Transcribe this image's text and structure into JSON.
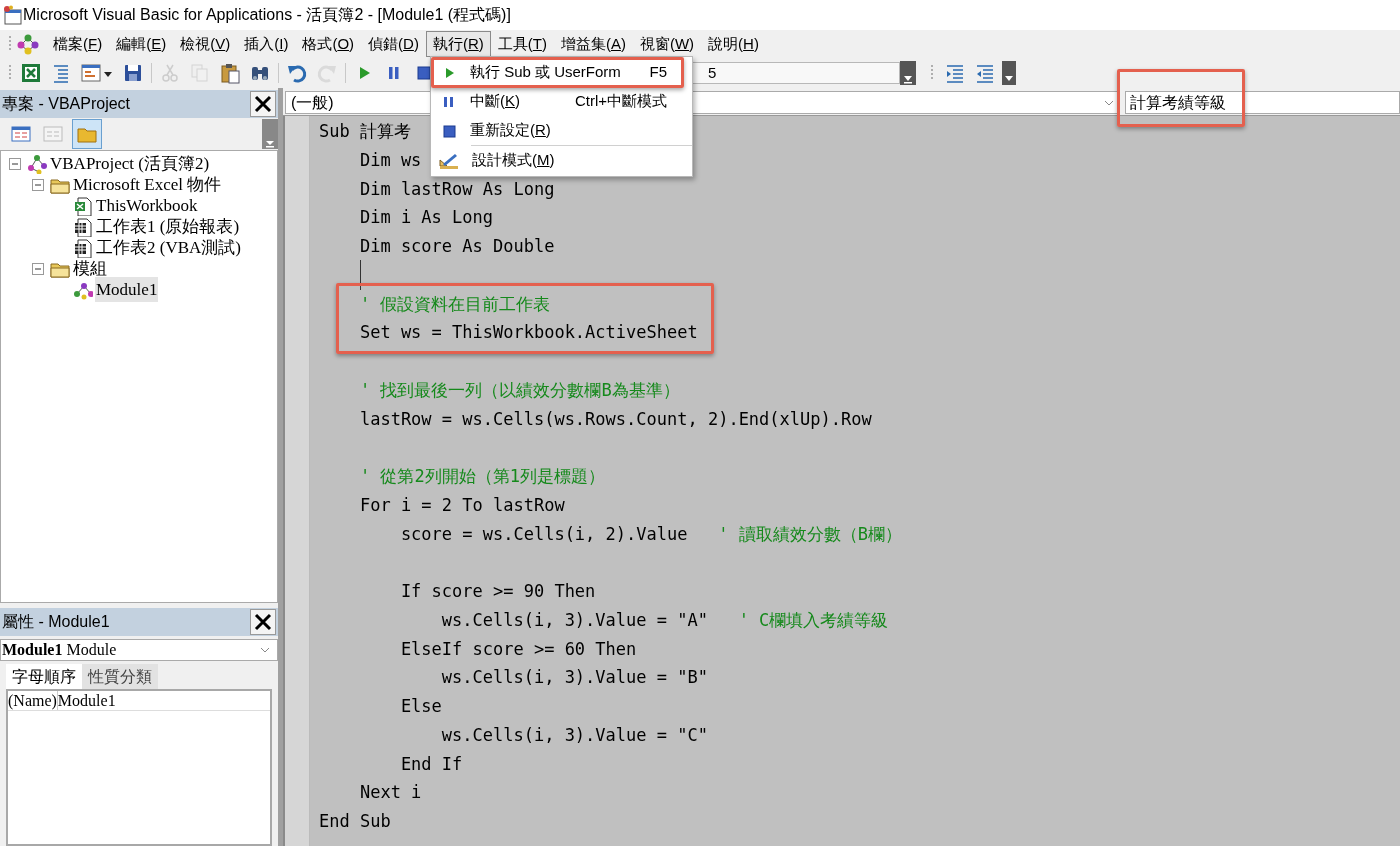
{
  "window": {
    "title": "Microsoft Visual Basic for Applications - 活頁簿2 - [Module1 (程式碼)]"
  },
  "menu_bar": [
    {
      "label": "檔案(F)",
      "selected": false
    },
    {
      "label": "編輯(E)",
      "selected": false
    },
    {
      "label": "檢視(V)",
      "selected": false
    },
    {
      "label": "插入(I)",
      "selected": false
    },
    {
      "label": "格式(O)",
      "selected": false
    },
    {
      "label": "偵錯(D)",
      "selected": false
    },
    {
      "label": "執行(R)",
      "selected": true
    },
    {
      "label": "工具(T)",
      "selected": false
    },
    {
      "label": "增益集(A)",
      "selected": false
    },
    {
      "label": "視窗(W)",
      "selected": false
    },
    {
      "label": "說明(H)",
      "selected": false
    }
  ],
  "toolbar": {
    "buttons": [
      {
        "disabled": false
      },
      {
        "disabled": false
      },
      {
        "disabled": false
      },
      {
        "disabled": false
      },
      {
        "disabled": true
      },
      {
        "disabled": true
      },
      {
        "disabled": false
      },
      {
        "disabled": false
      },
      {
        "disabled": false
      },
      {
        "disabled": true
      },
      {
        "disabled": false
      },
      {
        "disabled": false
      },
      {
        "disabled": false
      }
    ],
    "field_text": "5"
  },
  "run_menu": {
    "items": [
      {
        "kind": "item",
        "label": "執行 Sub 或 UserForm",
        "shortcut": "F5",
        "highlighted": true
      },
      {
        "kind": "item",
        "label": "中斷(K)",
        "shortcut": "Ctrl+中斷模式",
        "highlighted": false
      },
      {
        "kind": "item",
        "label": "重新設定(R)",
        "highlighted": false
      },
      {
        "kind": "separator"
      },
      {
        "kind": "item",
        "label": "設計模式(M)",
        "highlighted": false
      }
    ]
  },
  "project_panel": {
    "title": "專案 - VBAProject",
    "tree": [
      {
        "kind": "project",
        "label": "VBAProject (活頁簿2)",
        "expanded": true,
        "selected": false,
        "children": [
          {
            "kind": "folder",
            "label": "Microsoft Excel 物件",
            "expanded": true,
            "selected": false,
            "children": [
              {
                "kind": "workbook",
                "label": "ThisWorkbook",
                "selected": false
              },
              {
                "kind": "sheet",
                "label": "工作表1 (原始報表)",
                "selected": false
              },
              {
                "kind": "sheet",
                "label": "工作表2 (VBA測試)",
                "selected": false
              }
            ]
          },
          {
            "kind": "folder",
            "label": "模組",
            "expanded": true,
            "selected": false,
            "children": [
              {
                "kind": "module",
                "label": "Module1",
                "selected": true
              }
            ]
          }
        ]
      }
    ]
  },
  "properties_panel": {
    "title": "屬性 - Module1",
    "object": "**Module1** Module",
    "tabs": [
      {
        "label": "字母順序",
        "selected": true
      },
      {
        "label": "性質分類",
        "selected": false
      }
    ],
    "rows": [
      {
        "name": "(Name)",
        "value": "Module1"
      }
    ]
  },
  "code_window": {
    "object_box": "(一般)",
    "procedure_box": {
      "value": "計算考績等級",
      "highlighted": true
    },
    "lines": [
      {
        "kind": "code",
        "text": "Sub 計算考",
        "highlighted": false
      },
      {
        "kind": "code",
        "text": "    Dim ws",
        "highlighted": false
      },
      {
        "kind": "code",
        "text": "    Dim lastRow As Long",
        "highlighted": false
      },
      {
        "kind": "code",
        "text": "    Dim i As Long",
        "highlighted": false
      },
      {
        "kind": "code",
        "text": "    Dim score As Double",
        "highlighted": false
      },
      {
        "kind": "blank",
        "cursor": true,
        "highlighted": false
      },
      {
        "kind": "comment",
        "text": "    ' 假設資料在目前工作表",
        "highlighted": true
      },
      {
        "kind": "code",
        "text": "    Set ws = ThisWorkbook.ActiveSheet",
        "highlighted": true
      },
      {
        "kind": "blank",
        "cursor": false,
        "highlighted": false
      },
      {
        "kind": "comment",
        "text": "    ' 找到最後一列（以績效分數欄B為基準）",
        "highlighted": false
      },
      {
        "kind": "code",
        "text": "    lastRow = ws.Cells(ws.Rows.Count, 2).End(xlUp).Row",
        "highlighted": false
      },
      {
        "kind": "blank",
        "cursor": false,
        "highlighted": false
      },
      {
        "kind": "comment",
        "text": "    ' 從第2列開始（第1列是標題）",
        "highlighted": false
      },
      {
        "kind": "code",
        "text": "    For i = 2 To lastRow",
        "highlighted": false
      },
      {
        "kind": "mixed",
        "text": "        score = ws.Cells(i, 2).Value",
        "comment": "   ' 讀取績效分數（B欄）",
        "highlighted": false
      },
      {
        "kind": "blank",
        "cursor": false,
        "highlighted": false
      },
      {
        "kind": "code",
        "text": "        If score >= 90 Then",
        "highlighted": false
      },
      {
        "kind": "mixed",
        "text": "            ws.Cells(i, 3).Value = \"A\"",
        "comment": "   ' C欄填入考績等級",
        "highlighted": false
      },
      {
        "kind": "code",
        "text": "        ElseIf score >= 60 Then",
        "highlighted": false
      },
      {
        "kind": "code",
        "text": "            ws.Cells(i, 3).Value = \"B\"",
        "highlighted": false
      },
      {
        "kind": "code",
        "text": "        Else",
        "highlighted": false
      },
      {
        "kind": "code",
        "text": "            ws.Cells(i, 3).Value = \"C\"",
        "highlighted": false
      },
      {
        "kind": "code",
        "text": "        End If",
        "highlighted": false
      },
      {
        "kind": "code",
        "text": "    Next i",
        "highlighted": false
      },
      {
        "kind": "code",
        "text": "End Sub",
        "highlighted": false
      }
    ]
  }
}
